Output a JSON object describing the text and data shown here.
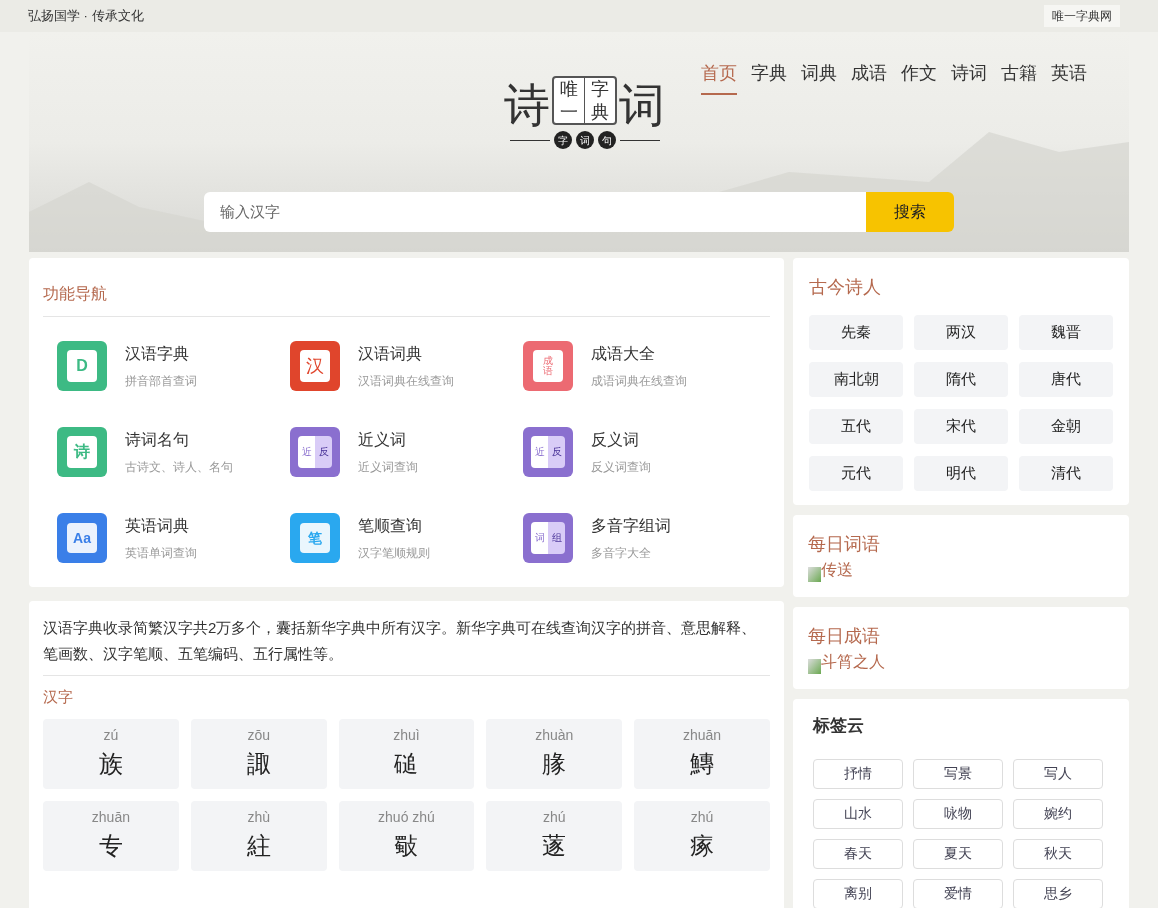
{
  "top_bar": {
    "slogan": "弘扬国学 · 传承文化",
    "site_link": "唯一字典网"
  },
  "nav": [
    {
      "label": "首页",
      "selected": true
    },
    {
      "label": "字典",
      "selected": false
    },
    {
      "label": "词典",
      "selected": false
    },
    {
      "label": "成语",
      "selected": false
    },
    {
      "label": "作文",
      "selected": false
    },
    {
      "label": "诗词",
      "selected": false
    },
    {
      "label": "古籍",
      "selected": false
    },
    {
      "label": "英语",
      "selected": false
    }
  ],
  "logo": {
    "left": "诗",
    "book_left": [
      "唯",
      "一"
    ],
    "book_right": [
      "字",
      "典"
    ],
    "right": "词",
    "seals": [
      "字",
      "词",
      "句"
    ]
  },
  "search": {
    "placeholder": "输入汉字",
    "button": "搜索"
  },
  "features": {
    "title": "功能导航",
    "items": [
      {
        "name": "汉语字典",
        "desc": "拼音部首查词",
        "color": "#3dba84",
        "icon_text": [
          "D"
        ],
        "kind": "book"
      },
      {
        "name": "汉语词典",
        "desc": "汉语词典在线查询",
        "color": "#e0452c",
        "icon_text": [
          "汉"
        ],
        "kind": "note"
      },
      {
        "name": "成语大全",
        "desc": "成语词典在线查询",
        "color": "#ec6a72",
        "icon_text": [
          "成",
          "语"
        ],
        "kind": "note"
      },
      {
        "name": "诗词名句",
        "desc": "古诗文、诗人、名句",
        "color": "#3dba84",
        "icon_text": [
          "诗"
        ],
        "kind": "book"
      },
      {
        "name": "近义词",
        "desc": "近义词查询",
        "color": "#8a6fcf",
        "icon_text": [
          "近",
          "反"
        ],
        "kind": "split"
      },
      {
        "name": "反义词",
        "desc": "反义词查询",
        "color": "#8a6fcf",
        "icon_text": [
          "近",
          "反"
        ],
        "kind": "split"
      },
      {
        "name": "英语词典",
        "desc": "英语单词查询",
        "color": "#3a7fe8",
        "icon_text": [
          "Aa"
        ],
        "kind": "card"
      },
      {
        "name": "笔顺查询",
        "desc": "汉字笔顺规则",
        "color": "#2aa8ef",
        "icon_text": [
          "笔"
        ],
        "kind": "card"
      },
      {
        "name": "多音字组词",
        "desc": "多音字大全",
        "color": "#8a6fcf",
        "icon_text": [
          "词",
          "组"
        ],
        "kind": "split"
      }
    ]
  },
  "intro": "汉语字典收录简繁汉字共2万多个，囊括新华字典中所有汉字。新华字典可在线查询汉字的拼音、意思解释、笔画数、汉字笔顺、五笔编码、五行属性等。",
  "characters": {
    "title": "汉字",
    "items": [
      {
        "pinyin": "zú",
        "char": "族"
      },
      {
        "pinyin": "zōu",
        "char": "諏"
      },
      {
        "pinyin": "zhuì",
        "char": "磓"
      },
      {
        "pinyin": "zhuàn",
        "char": "腞"
      },
      {
        "pinyin": "zhuān",
        "char": "鱄"
      },
      {
        "pinyin": "zhuān",
        "char": "专"
      },
      {
        "pinyin": "zhù",
        "char": "紸"
      },
      {
        "pinyin": "zhuó zhú",
        "char": "斀"
      },
      {
        "pinyin": "zhú",
        "char": "蓫"
      },
      {
        "pinyin": "zhú",
        "char": "瘃"
      }
    ]
  },
  "poets": {
    "title": "古今诗人",
    "items": [
      "先秦",
      "两汉",
      "魏晋",
      "南北朝",
      "隋代",
      "唐代",
      "五代",
      "宋代",
      "金朝",
      "元代",
      "明代",
      "清代"
    ]
  },
  "daily_word": {
    "title": "每日词语",
    "image_alt": "传送"
  },
  "daily_idiom": {
    "title": "每日成语",
    "image_alt": "斗筲之人"
  },
  "tags": {
    "title": "标签云",
    "items": [
      "抒情",
      "写景",
      "写人",
      "山水",
      "咏物",
      "婉约",
      "春天",
      "夏天",
      "秋天",
      "离别",
      "爱情",
      "思乡"
    ]
  }
}
